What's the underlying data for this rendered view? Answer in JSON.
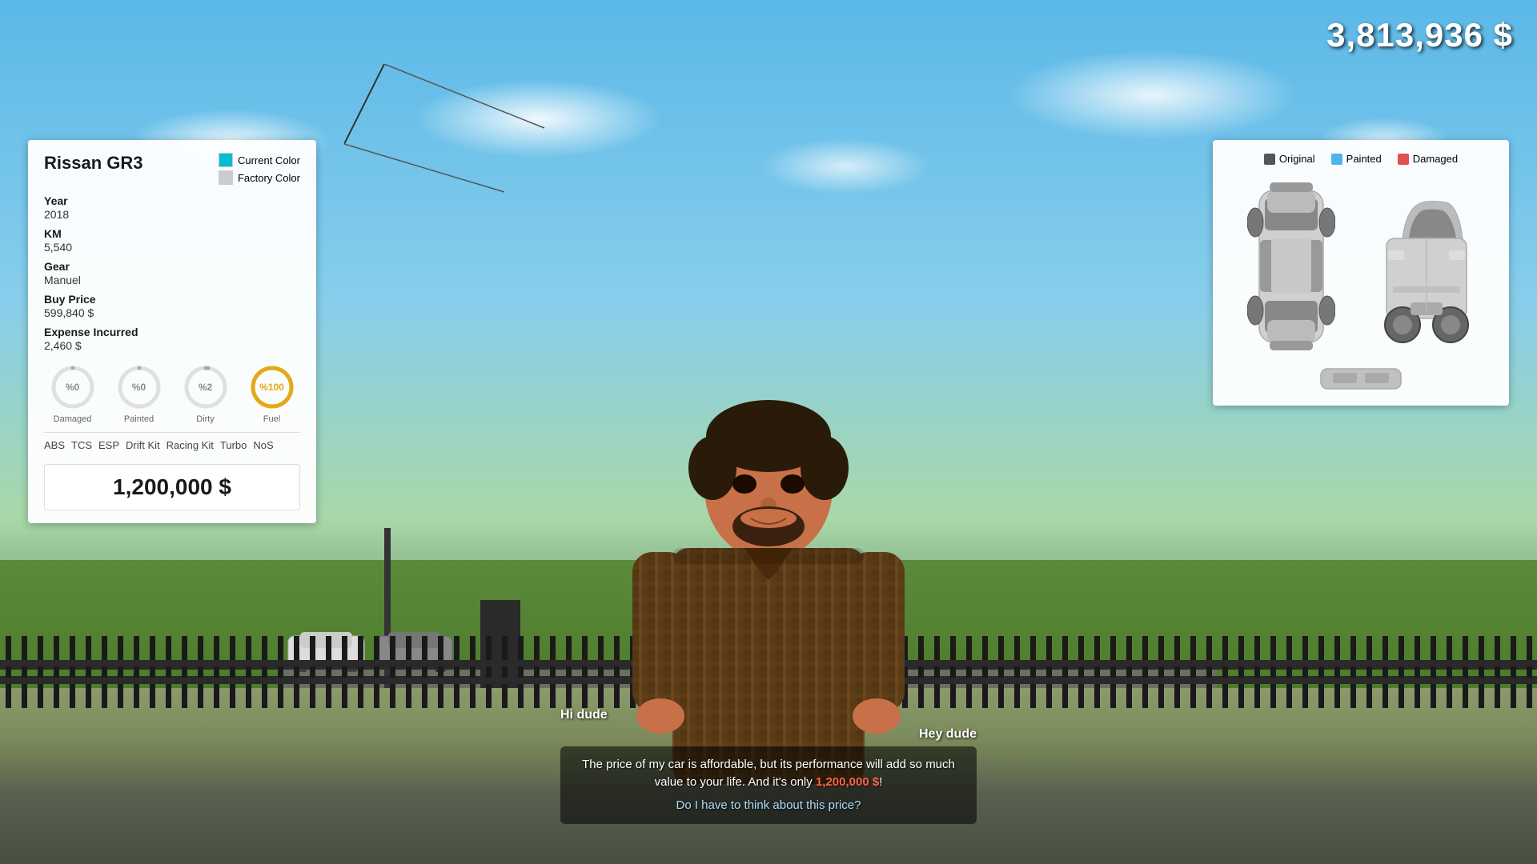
{
  "hud": {
    "money": "3,813,936 $"
  },
  "car_panel": {
    "title": "Rissan GR3",
    "color_current_label": "Current Color",
    "color_factory_label": "Factory Color",
    "color_current_hex": "#00bcd4",
    "color_factory_hex": "#cccccc",
    "year_label": "Year",
    "year_value": "2018",
    "km_label": "KM",
    "km_value": "5,540",
    "gear_label": "Gear",
    "gear_value": "Manuel",
    "buy_price_label": "Buy Price",
    "buy_price_value": "599,840 $",
    "expense_label": "Expense Incurred",
    "expense_value": "2,460 $",
    "conditions": [
      {
        "label": "Damaged",
        "value": "0",
        "percent": 0,
        "color": "#aaaaaa"
      },
      {
        "label": "Painted",
        "value": "0",
        "percent": 0,
        "color": "#aaaaaa"
      },
      {
        "label": "Dirty",
        "value": "2",
        "percent": 2,
        "color": "#aaaaaa"
      },
      {
        "label": "Fuel",
        "value": "100",
        "percent": 100,
        "color": "#e6a817"
      }
    ],
    "upgrades": [
      "ABS",
      "TCS",
      "ESP",
      "Drift Kit",
      "Racing Kit",
      "Turbo",
      "NoS"
    ],
    "sale_price": "1,200,000 $"
  },
  "diagram_panel": {
    "legend": [
      {
        "label": "Original",
        "color": "#555555"
      },
      {
        "label": "Painted",
        "color": "#4db6e8"
      },
      {
        "label": "Damaged",
        "color": "#e05050"
      }
    ]
  },
  "dialogue": {
    "speaker_left": "Hi dude",
    "speaker_right": "Hey dude",
    "text": "The price of my car is affordable, but its performance will add so much value to your life. And it's only 1,200,000 $!",
    "highlight": "1,200,000 $",
    "question": "Do I have to think about this price?"
  }
}
